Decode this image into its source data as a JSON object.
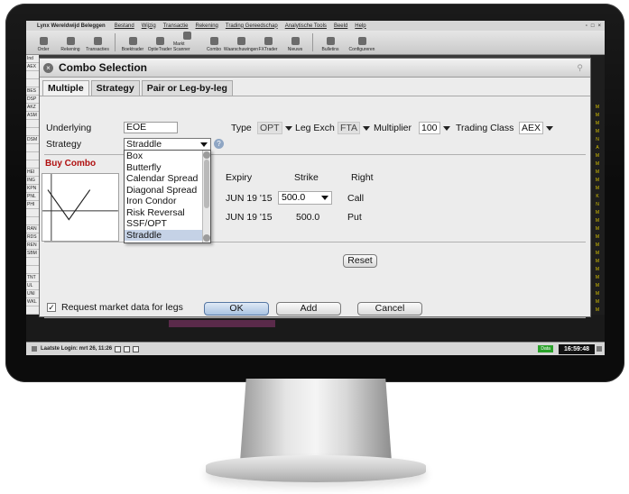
{
  "app": {
    "name": "Lynx Wereldwijd Beleggen",
    "menu": [
      "Bestand",
      "Wijzig",
      "Transactie",
      "Rekening",
      "Trading Gereedschap",
      "Analytische Tools",
      "Beeld",
      "Help"
    ],
    "toolbar": [
      "Order",
      "Rekening",
      "Transacties",
      "Boektrader",
      "OptieTrader",
      "Markt Scanner",
      "Combo",
      "Waarschuwingen",
      "FXTrader",
      "Nieuws",
      "Bulletins",
      "Configureren"
    ]
  },
  "dialog": {
    "title": "Combo Selection",
    "tabs": [
      "Multiple",
      "Strategy",
      "Pair or Leg-by-leg"
    ],
    "underlying_label": "Underlying",
    "underlying_value": "EOE",
    "type_label": "Type",
    "type_value": "OPT",
    "leg_exch_label": "Leg Exch",
    "leg_exch_value": "FTA",
    "multiplier_label": "Multiplier",
    "multiplier_value": "100",
    "trading_class_label": "Trading Class",
    "trading_class_value": "AEX",
    "strategy_label": "Strategy",
    "strategy_value": "Straddle",
    "strategy_options": [
      "Box",
      "Butterfly",
      "Calendar Spread",
      "Diagonal Spread",
      "Iron Condor",
      "Risk Reversal",
      "SSF/OPT",
      "Straddle"
    ],
    "buy_combo_label": "Buy Combo",
    "columns": {
      "expiry": "Expiry",
      "strike": "Strike",
      "right": "Right"
    },
    "legs": [
      {
        "expiry": "JUN 19 '15",
        "strike": "500.0",
        "right": "Call"
      },
      {
        "expiry": "JUN 19 '15",
        "strike": "500.0",
        "right": "Put"
      }
    ],
    "reset_label": "Reset",
    "request_market_data_label": "Request market data for legs",
    "request_market_data_checked": true,
    "ok_label": "OK",
    "add_label": "Add",
    "cancel_label": "Cancel"
  },
  "background": {
    "left_tickers": [
      "Ind",
      "AEX",
      "",
      "",
      "BES",
      "DSP",
      "AKZ",
      "ASM",
      "",
      "",
      "DSM",
      "",
      "",
      "",
      "HEI",
      "ING",
      "KPN",
      "PNL",
      "PHI",
      "",
      "",
      "RAN",
      "RDS",
      "REN",
      "SBM",
      "",
      "",
      "TNT",
      "UL",
      "UNI",
      "WKL",
      "",
      ""
    ],
    "right_letters": [
      "",
      "",
      "",
      "",
      "",
      "",
      "M",
      "M",
      "M",
      "M",
      "N",
      "A",
      "M",
      "M",
      "M",
      "M",
      "M",
      "K",
      "N",
      "M",
      "M",
      "M",
      "M",
      "M",
      "M",
      "M",
      "M",
      "M",
      "M",
      "M",
      "M",
      "M",
      "M"
    ]
  },
  "status": {
    "last_login": "Laatste Login: mrt 26, 11:26",
    "data_badge": "Data",
    "clock": "16:59:48"
  }
}
